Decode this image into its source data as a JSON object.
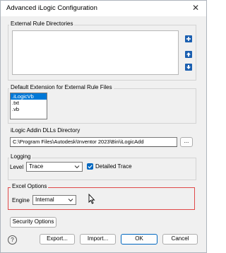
{
  "window": {
    "title": "Advanced iLogic Configuration",
    "close_glyph": "✕"
  },
  "external_rules": {
    "label": "External Rule Directories",
    "add_glyph": "+",
    "up_glyph": "↑",
    "down_glyph": "↓"
  },
  "default_extension": {
    "label": "Default Extension for External Rule Files",
    "options": [
      ".iLogicVb",
      ".txt",
      ".vb"
    ],
    "selected_index": 0
  },
  "addin_dlls": {
    "label": "iLogic Addin DLLs Directory",
    "path": "C:\\Program Files\\Autodesk\\Inventor 2023\\Bin\\iLogicAdd",
    "browse_label": "..."
  },
  "logging": {
    "label": "Logging",
    "level_label": "Level",
    "level_value": "Trace",
    "detailed_trace_label": "Detailed Trace",
    "detailed_trace_checked": true
  },
  "excel_options": {
    "label": "Excel Options",
    "engine_label": "Engine",
    "engine_value": "Internal",
    "highlight_color": "#e04a4a"
  },
  "buttons": {
    "security": "Security Options",
    "export": "Export...",
    "import": "Import...",
    "ok": "OK",
    "cancel": "Cancel",
    "help_glyph": "?"
  }
}
